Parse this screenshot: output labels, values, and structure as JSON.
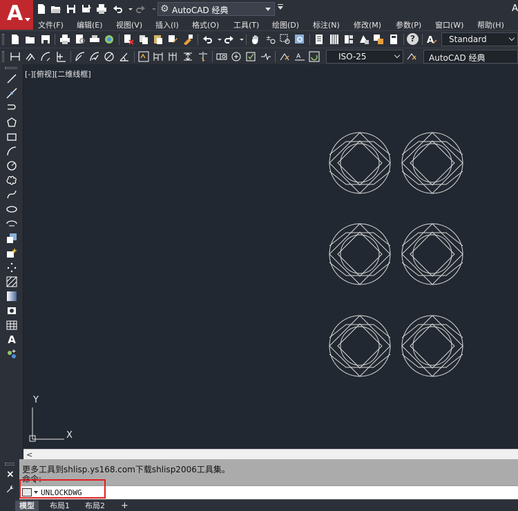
{
  "app": {
    "logo_letter": "A",
    "title_right": "A"
  },
  "quick_access": {
    "workspace": "AutoCAD 经典"
  },
  "menu": {
    "items": [
      "文件(F)",
      "编辑(E)",
      "视图(V)",
      "插入(I)",
      "格式(O)",
      "工具(T)",
      "绘图(D)",
      "标注(N)",
      "修改(M)",
      "参数(P)",
      "窗口(W)",
      "帮助(H)"
    ]
  },
  "toolbar": {
    "text_style": "Standard",
    "dim_style": "ISO-25",
    "workspace_combo": "AutoCAD 经典",
    "help_label": "?"
  },
  "canvas": {
    "viewport_label": "[-][俯视][二维线框]",
    "ucs_x": "X",
    "ucs_y": "Y",
    "background": "#222831",
    "stroke": "#d8d8d8"
  },
  "scrollbar": {
    "left_arrow": "<"
  },
  "command": {
    "history": [
      "更多工具到shlisp.ys168.com下载shlisp2006工具集。",
      "命令:"
    ],
    "input": "UNLOCKDWG",
    "close_symbol": "×"
  },
  "tabs": {
    "items": [
      "模型",
      "布局1",
      "布局2"
    ],
    "active": "模型",
    "add": "+"
  },
  "colors": {
    "highlight": "#e02020",
    "logo_red": "#c0282d"
  }
}
